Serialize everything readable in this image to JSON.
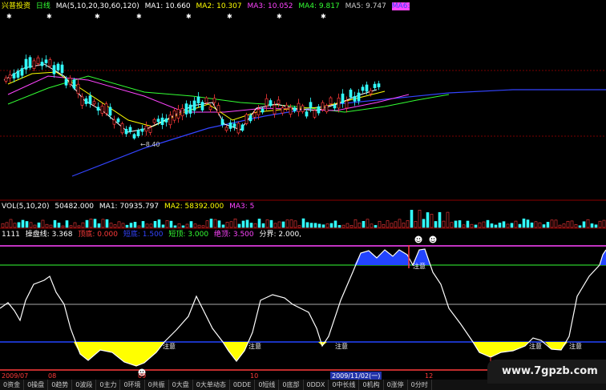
{
  "header": {
    "title": "兴普投资",
    "period": "日线",
    "ma_label": "MA(5,10,20,30,60,120)",
    "ma1": "MA1: 10.660",
    "ma2": "MA2: 10.307",
    "ma3": "MA3: 10.052",
    "ma4": "MA4: 9.817",
    "ma5": "MA5: 9.747",
    "ma6": "MA6:"
  },
  "price_annotation": "←8.40",
  "volume": {
    "label": "VOL(5,10,20)",
    "value": "50482.000",
    "ma1": "MA1: 70935.797",
    "ma2": "MA2: 58392.000",
    "ma3": "MA3: 5"
  },
  "indicator": {
    "code": "1111",
    "name": "操盘线: 3.368",
    "l1": "顶底: 0.000",
    "l2": "短底: 1.500",
    "l3": "短顶: 3.000",
    "l4": "绝顶: 3.500",
    "l5": "分界: 2.000,",
    "warnings": [
      "注意",
      "注意",
      "注意",
      "注意",
      "注意",
      "注意"
    ]
  },
  "dates": [
    "2009/07",
    "08",
    "09",
    "10",
    "2009/11/02(一)",
    "12"
  ],
  "tabs": [
    "0资金",
    "0操盘",
    "0趋势",
    "0波段",
    "0主力",
    "0环境",
    "0共振",
    "0大盘",
    "0大单动态",
    "0DDE",
    "0短线",
    "0底部",
    "0DDX",
    "0中长线",
    "0机构",
    "0涨停",
    "0分时"
  ],
  "watermark": "www.7gpzb.com",
  "colors": {
    "bull": "#ff3a3a",
    "bear": "#33ffff",
    "ma1": "#ffffff",
    "ma2": "#ffff00",
    "ma3": "#ff44ff",
    "ma4": "#33ff33",
    "ma5": "#3344ff",
    "bottom_fill": "#ffff00",
    "top_fill": "#2244ff"
  }
}
